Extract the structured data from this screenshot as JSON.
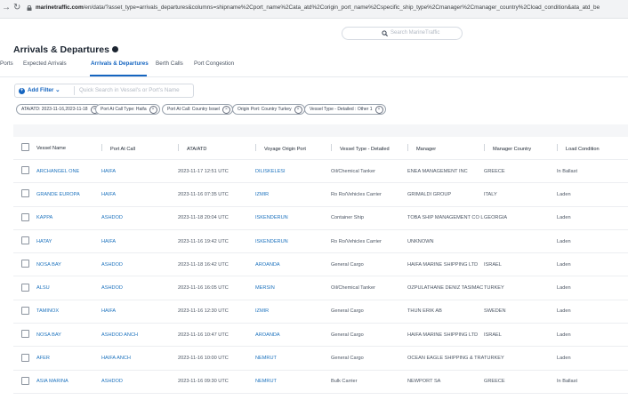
{
  "browser": {
    "url_host": "marinetraffic.com",
    "url_rest": "/en/data/?asset_type=arrivals_departures&columns=shipname%2Cport_name%2Cata_atd%2Corigin_port_name%2Cspecific_ship_type%2Cmanager%2Cmanager_country%2Cload_condition&ata_atd_be"
  },
  "search": {
    "placeholder": "Search MarineTraffic"
  },
  "page": {
    "title": "Arrivals & Departures"
  },
  "tabs": [
    "Ports",
    "Expected Arrivals",
    "Arrivals & Departures",
    "Berth Calls",
    "Port Congestion"
  ],
  "filter": {
    "add_label": "Add Filter",
    "chevron": "⌄",
    "placeholder": "Quick Search in Vessel's or Port's Name"
  },
  "chips": [
    "ATA/ATD: 2023-11-16,2023-11-18",
    "Port At Call Type: Haifa",
    "Port At Call: Country Israel",
    "Origin Port: Country Turkey",
    "Vessel Type - Detailed : Other 1"
  ],
  "table": {
    "columns": [
      "Vessel Name",
      "Port At Call",
      "ATA/ATD",
      "Voyage Origin Port",
      "Vessel Type - Detailed",
      "Manager",
      "Manager Country",
      "Load Condition"
    ],
    "rows": [
      [
        "ARCHANGEL ONE",
        "HAIFA",
        "2023-11-17 12:51 UTC",
        "DILISKELESI",
        "Oil/Chemical Tanker",
        "ENEA MANAGEMENT INC",
        "GREECE",
        "In Ballast"
      ],
      [
        "GRANDE EUROPA",
        "HAIFA",
        "2023-11-16 07:35 UTC",
        "IZMIR",
        "Ro Ro/Vehicles Carrier",
        "GRIMALDI GROUP",
        "ITALY",
        "Laden"
      ],
      [
        "KAPPA",
        "ASHDOD",
        "2023-11-18 20:04 UTC",
        "ISKENDERUN",
        "Container Ship",
        "TOBA SHIP MANAGEMENT CO L",
        "GEORGIA",
        "Laden"
      ],
      [
        "HATAY",
        "HAIFA",
        "2023-11-16 19:42 UTC",
        "ISKENDERUN",
        "Ro Ro/Vehicles Carrier",
        "UNKNOWN",
        "",
        "Laden"
      ],
      [
        "NOSA BAY",
        "ASHDOD",
        "2023-11-18 16:42 UTC",
        "AROANDA",
        "General Cargo",
        "HAIFA MARINE SHIPPING LTD",
        "ISRAEL",
        "Laden"
      ],
      [
        "ALSU",
        "ASHDOD",
        "2023-11-16 16:05 UTC",
        "MERSIN",
        "Oil/Chemical Tanker",
        "OZPULATHANE DENIZ TASIMAC",
        "TURKEY",
        "Laden"
      ],
      [
        "TAMINOX",
        "HAIFA",
        "2023-11-16 12:30 UTC",
        "IZMIR",
        "General Cargo",
        "THUN ERIK AB",
        "SWEDEN",
        "Laden"
      ],
      [
        "NOSA BAY",
        "ASHDOD ANCH",
        "2023-11-16 10:47 UTC",
        "AROANDA",
        "General Cargo",
        "HAIFA MARINE SHIPPING LTD",
        "ISRAEL",
        "Laden"
      ],
      [
        "AFER",
        "HAIFA ANCH",
        "2023-11-16 10:00 UTC",
        "NEMRUT",
        "General Cargo",
        "OCEAN EAGLE SHIPPING & TRA",
        "TURKEY",
        "Laden"
      ],
      [
        "ASIA MARINA",
        "ASHDOD",
        "2023-11-16 09:30 UTC",
        "NEMRUT",
        "Bulk Carrier",
        "NEWPORT SA",
        "GREECE",
        "In Ballast"
      ]
    ]
  }
}
